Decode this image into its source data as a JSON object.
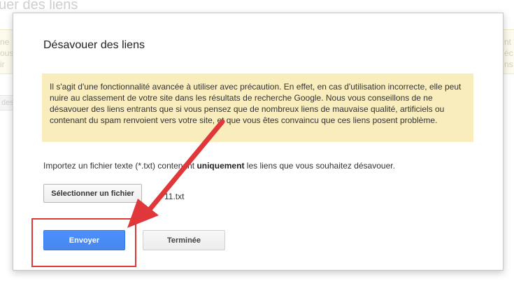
{
  "background": {
    "title_fragment": "uer des liens",
    "notice_left_lines": [
      "ne",
      "ous",
      "ir"
    ],
    "notice_right_lines": [
      "nt",
      "éc",
      "ns"
    ],
    "tab_fragment": "des"
  },
  "dialog": {
    "title": "Désavouer des liens",
    "warning": "Il s'agit d'une fonctionnalité avancée à utiliser avec précaution. En effet, en cas d'utilisation incorrecte, elle peut nuire au classement de votre site dans les résultats de recherche Google. Nous vous conseillons de ne désavouer des liens entrants que si vous pensez que de nombreux liens de mauvaise qualité, artificiels ou contenant du spam renvoient vers votre site, et que vous êtes convaincu que ces liens posent problème.",
    "instruction_before": "Importez un fichier texte (*.txt) contenant ",
    "instruction_bold": "uniquement",
    "instruction_after": " les liens que vous souhaitez désavouer.",
    "choose_file_label": "Sélectionner un fichier",
    "file_name": "11.txt",
    "send_label": "Envoyer",
    "done_label": "Terminée"
  },
  "annotation": {
    "color": "#e0383a"
  }
}
